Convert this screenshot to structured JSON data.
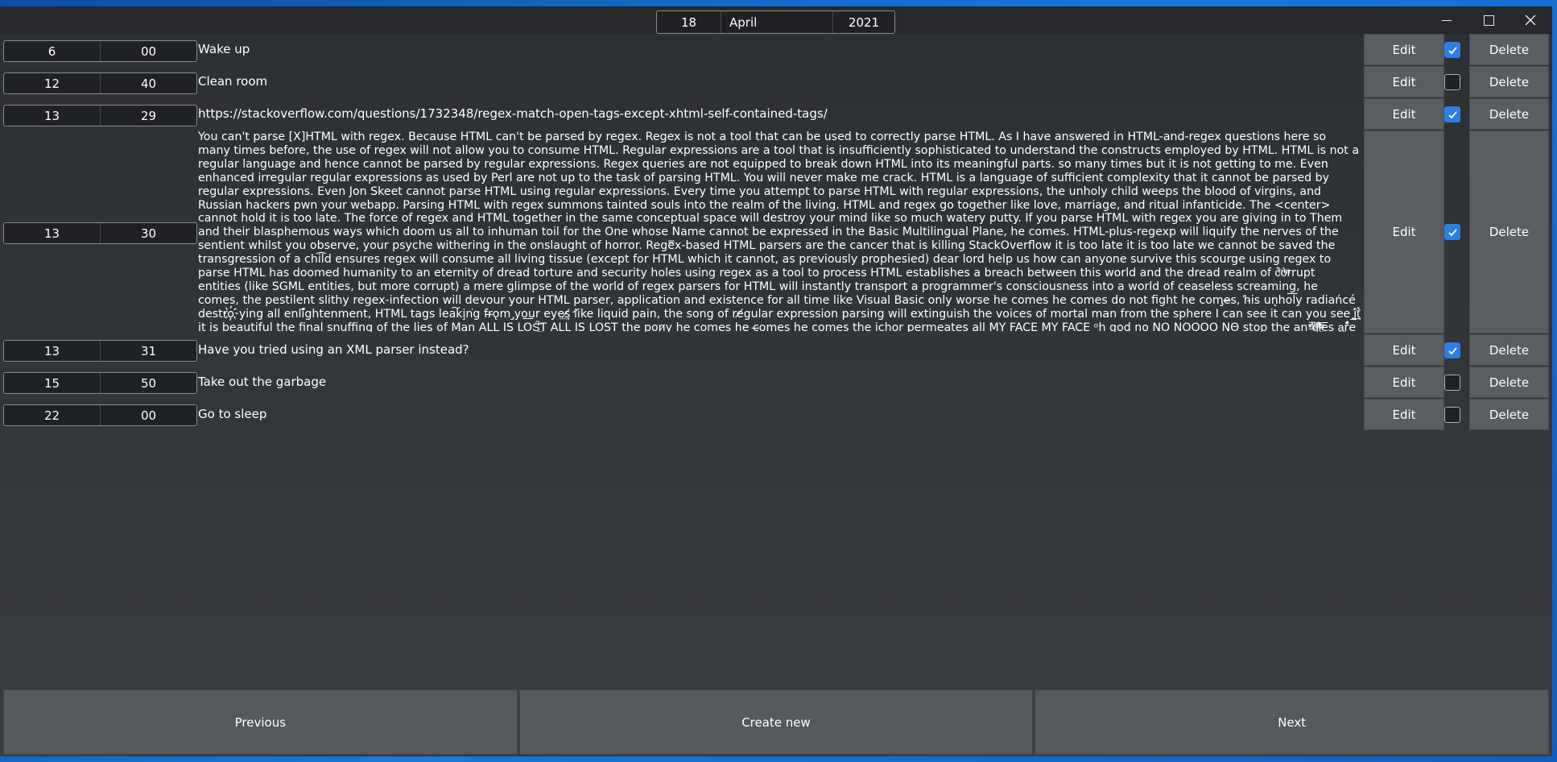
{
  "date": {
    "day": "18",
    "month": "April",
    "year": "2021"
  },
  "labels": {
    "edit": "Edit",
    "delete": "Delete"
  },
  "tasks": [
    {
      "hour": "6",
      "minute": "00",
      "text": "Wake up",
      "checked": true
    },
    {
      "hour": "12",
      "minute": "40",
      "text": "Clean room",
      "checked": false
    },
    {
      "hour": "13",
      "minute": "29",
      "text": "https://stackoverflow.com/questions/1732348/regex-match-open-tags-except-xhtml-self-contained-tags/",
      "checked": true
    },
    {
      "hour": "13",
      "minute": "30",
      "text": "You can't parse [X]HTML with regex. Because HTML can't be parsed by regex. Regex is not a tool that can be used to correctly parse HTML. As I have answered in HTML-and-regex questions here so many times before, the use of regex will not allow you to consume HTML. Regular expressions are a tool that is insufficiently sophisticated to understand the constructs employed by HTML. HTML is not a regular language and hence cannot be parsed by regular expressions. Regex queries are not equipped to break down HTML into its meaningful parts. so many times but it is not getting to me. Even enhanced irregular regular expressions as used by Perl are not up to the task of parsing HTML. You will never make me crack. HTML is a language of sufficient complexity that it cannot be parsed by regular expressions. Even Jon Skeet cannot parse HTML using regular expressions. Every time you attempt to parse HTML with regular expressions, the unholy child weeps the blood of virgins, and Russian hackers pwn your webapp. Parsing HTML with regex summons tainted souls into the realm of the living. HTML and regex go together like love, marriage, and ritual infanticide. The <center> cannot hold it is too late. The force of regex and HTML together in the same conceptual space will destroy your mind like so much watery putty. If you parse HTML with regex you are giving in to Them and their blasphemous ways which doom us all to inhuman toil for the One whose Name cannot be expressed in the Basic Multilingual Plane, he comes. HTML-plus-regexp will liquify the nerves of the sentient whilst you observe, your psyche withering in the onslaught of horror. Rege̿x-based HTML parsers are the cancer that is killing StackOverflow it is too late it is too late we cannot be saved the transgression of a chi͡ld ensures regex will consume all living tissue (except for HTML which it cannot, as previously prophesied) dear lord help us how can anyone survive this scourge using regex to parse HTML has doomed humanity to an eternity of dread torture and security holes using regex as a tool to process HTML establishes a breach between this world and the dread realm of c͒ͪo͛ͫrrupt entities (like SGML entities, but more corrupt) a mere glimpse of the world of regex parsers for HTML will instantly transport a programmer's consciousness into a world of ceaseless screaming, he comes, the pestilent slithy regex-infection will devour your HTML parser, application and existence for all time like Visual Basic only worse he comes he comes do not fight he com̡e̶s, ̕h̵is un̨ho͞ly radiańcé destro҉ying all enli̍̈́̂̈́ghtenment, HTML tags lea͠ki̧n͘g fr̶ǫm ̡yo͟ur eye͢s̸ ̛l̕ik͏e liquid pain, the song of re̸gular expression parsing will extinguish the voices of mortal man from the sphere I can see it can you see ̲͚̖͔̙î̩́t̲͎̩̱͔́̋̀ it is beautiful the final snuffing of the lies of Man ALL IS LOŚ͖̩͇̗̪̏̈́T ALL IS LOST the pon̷y he comes he c̶̮omes he comes the ichor permeates all MY FACE MY FACE ᵒh god no NO NOO̼OO NΘ stop the an*̶͑̾̾̅ͫ͏̙̤g͛͆̾ͫ̑͆l͖͉̗̩̳̟̍ͫͥͨe̠̅s ͎a̧͈͖r̽̾̈́͒͑e not rè̑ͧ̌aͨl̘̝̙̃ͤ͂̾̆ ZA̡͊͠͝LGΌ ISͮ̂҉̯͈͕̹̘̱ TO͇̹̺ͅƝ̴ȳ̳ TH̘Ë͖́̉ ͠P̯͍̭O̚N̐Y̡ H̸̡̪̯ͨ͊̽̅̾̎Ȩ̬̩̾͛ͪ̈́̀́͘ ̶̧̨̱̹̭̯ͧ̾ͬC̷̙̲̝͖ͭ̏ͥͮ͟Oͮ͏̮̪̝͍M̲̖͊̒ͪͩͬ̚̚͜Ȇ̴̟̟͙̞ͩ͌͝S̨̥̫͎̭ͯ̿̔̀ͅ",
      "checked": true
    },
    {
      "hour": "13",
      "minute": "31",
      "text": "Have you tried using an XML parser instead?",
      "checked": true
    },
    {
      "hour": "15",
      "minute": "50",
      "text": "Take out the garbage",
      "checked": false
    },
    {
      "hour": "22",
      "minute": "00",
      "text": "Go to sleep",
      "checked": false
    }
  ],
  "footer": {
    "previous": "Previous",
    "create": "Create new",
    "next": "Next"
  }
}
